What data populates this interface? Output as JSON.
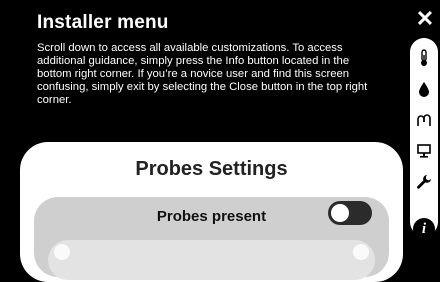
{
  "header": {
    "title": "Installer menu",
    "description": "Scroll down to access all available customizations. To access additional guidance, simply press the Info button located in the bottom right corner. If you’re a novice user and find this screen confusing, simply exit by selecting the Close button in the top right corner.",
    "close_label": "✕"
  },
  "sidebar": {
    "items": [
      {
        "icon": "thermometer-icon"
      },
      {
        "icon": "water-drop-icon"
      },
      {
        "icon": "probes-icon"
      },
      {
        "icon": "monitor-icon"
      },
      {
        "icon": "wrench-icon"
      }
    ]
  },
  "info_button": {
    "label": "i"
  },
  "card": {
    "title": "Probes Settings",
    "probes_present": {
      "label": "Probes present",
      "enabled": false
    }
  }
}
